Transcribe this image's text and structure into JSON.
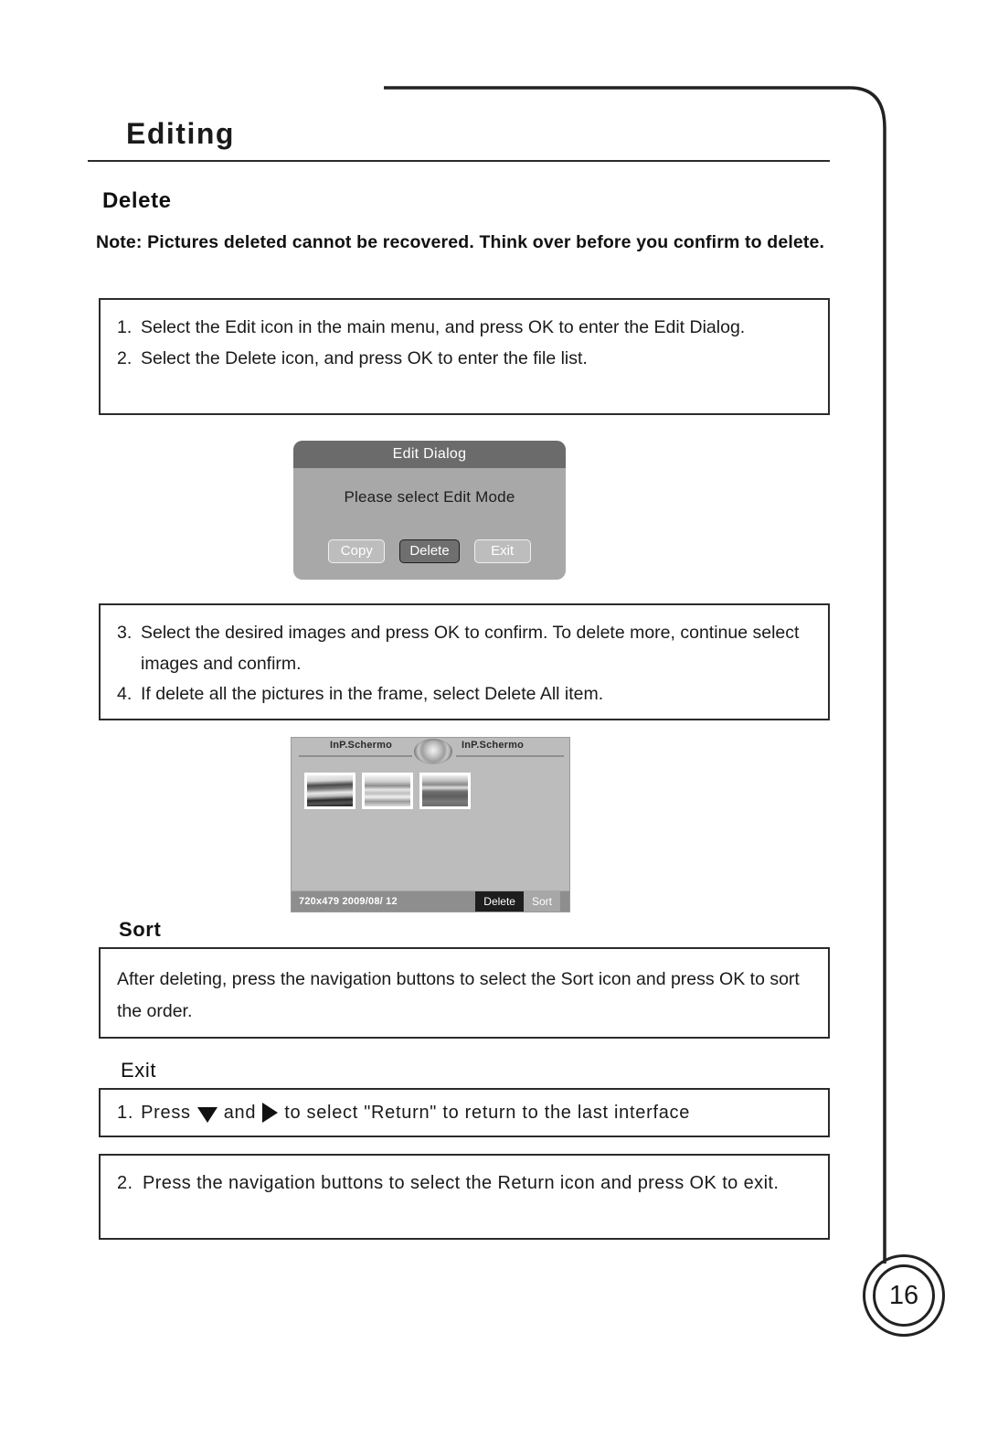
{
  "document": {
    "page_title": "Editing",
    "page_number": "16"
  },
  "delete_section": {
    "heading": "Delete",
    "note": "Note: Pictures deleted cannot be recovered. Think over before you confirm to delete.",
    "steps_12": [
      {
        "num": "1.",
        "text": "Select the Edit icon in the main menu, and press OK to enter the Edit Dialog."
      },
      {
        "num": "2.",
        "text": "Select the Delete icon, and press OK to enter the file list."
      }
    ],
    "steps_34": [
      {
        "num": "3.",
        "text": "Select the desired images and press OK to confirm. To delete more, continue select images and confirm."
      },
      {
        "num": "4.",
        "text": "If delete all the pictures in the frame, select Delete All item."
      }
    ]
  },
  "edit_dialog": {
    "title": "Edit Dialog",
    "message": "Please select Edit Mode",
    "buttons": [
      {
        "label": "Copy",
        "selected": false
      },
      {
        "label": "Delete",
        "selected": true
      },
      {
        "label": "Exit",
        "selected": false
      }
    ]
  },
  "file_list": {
    "tab_left": "InP.Schermo",
    "tab_right": "InP.Schermo",
    "meta": "720x479 2009/08/ 12",
    "actions": [
      {
        "label": "Delete",
        "selected": true
      },
      {
        "label": "Sort",
        "selected": false
      }
    ],
    "thumbnail_count": 3
  },
  "sort_section": {
    "heading": "Sort",
    "text": "After deleting, press the navigation buttons to select the Sort icon and press OK to sort the order."
  },
  "exit_section": {
    "heading": "Exit",
    "step1": {
      "num": "1.",
      "before": "Press",
      "middle": "and",
      "after": "to  select \"Return\"  to return  to the last interface",
      "icon_down": "down-triangle",
      "icon_right": "right-triangle"
    },
    "step2": {
      "num": "2.",
      "text": "Press the navigation buttons to select the Return icon and press OK to exit."
    }
  },
  "colors": {
    "ink": "#1a1a1a",
    "dialog_titlebar": "#6b6b6b",
    "dialog_body": "#a8a8a8",
    "panel_bg": "#bcbcbc",
    "status_bar": "#8e8e8e",
    "selected_dark": "#1d1d1d"
  }
}
